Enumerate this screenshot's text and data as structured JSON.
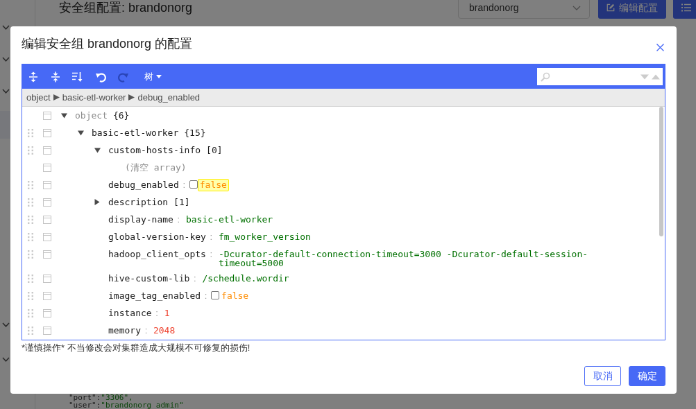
{
  "background_page": {
    "title": "安全组配置: brandonorg",
    "select": {
      "value": "brandonorg"
    },
    "buttons": [
      {
        "kind": "edit",
        "label": "编辑配置"
      },
      {
        "kind": "list"
      }
    ],
    "code_lines": [
      {
        "key": "\"port\":",
        "value": "\"3306\","
      },
      {
        "key": "\"user\":",
        "value": "\"brandonorg_admin\""
      }
    ]
  },
  "dialog": {
    "title": "编辑安全组 brandonorg 的配置",
    "editor": {
      "toolbar": {
        "buttons": [
          {
            "kind": "expand-all",
            "disabled": false
          },
          {
            "kind": "collapse-all",
            "disabled": false
          },
          {
            "kind": "sort",
            "disabled": false
          },
          {
            "kind": "undo",
            "disabled": false
          },
          {
            "kind": "redo",
            "disabled": true
          }
        ],
        "mode": "树"
      },
      "breadcrumb": [
        {
          "label": "object"
        },
        {
          "label": "basic-etl-worker"
        },
        {
          "label": "debug_enabled"
        }
      ],
      "tree": {
        "key": "object",
        "kind": "object",
        "count": "{6}",
        "expanded": true,
        "children": [
          {
            "key": "basic-etl-worker",
            "kind": "object",
            "count": "{15}",
            "expanded": true,
            "children": [
              {
                "key": "custom-hosts-info",
                "kind": "array",
                "count": "[0]",
                "expanded": true,
                "children": [
                  {
                    "kind": "empty",
                    "text": "(清空 array)"
                  }
                ]
              },
              {
                "key": "debug_enabled",
                "separator": ":",
                "kind": "boolean",
                "value": "false",
                "checked": false,
                "highlighted": true
              },
              {
                "key": "description",
                "kind": "array",
                "count": "[1]",
                "expanded": false
              },
              {
                "key": "display-name",
                "separator": ":",
                "kind": "string",
                "value": "basic-etl-worker",
                "highlighted": false
              },
              {
                "key": "global-version-key",
                "separator": ":",
                "kind": "string",
                "value": "fm_worker_version",
                "highlighted": false
              },
              {
                "key": "hadoop_client_opts",
                "separator": ":",
                "kind": "string",
                "value": "-Dcurator-default-connection-timeout=3000 -Dcurator-default-session-timeout=5000",
                "highlighted": false
              },
              {
                "key": "hive-custom-lib",
                "separator": ":",
                "kind": "string",
                "value": "/schedule.wordir",
                "highlighted": false
              },
              {
                "key": "image_tag_enabled",
                "separator": ":",
                "kind": "boolean",
                "value": "false",
                "checked": false,
                "highlighted": false
              },
              {
                "key": "instance",
                "separator": ":",
                "kind": "number",
                "value": "1",
                "highlighted": false
              },
              {
                "key": "memory",
                "separator": ":",
                "kind": "number",
                "value": "2048",
                "highlighted": false
              }
            ]
          }
        ]
      }
    },
    "warning": "*谨慎操作* 不当修改会对集群造成大规模不可修复的损伤!",
    "buttons": [
      {
        "kind": "secondary",
        "label": "取消"
      },
      {
        "kind": "primary",
        "label": "确定"
      }
    ]
  }
}
